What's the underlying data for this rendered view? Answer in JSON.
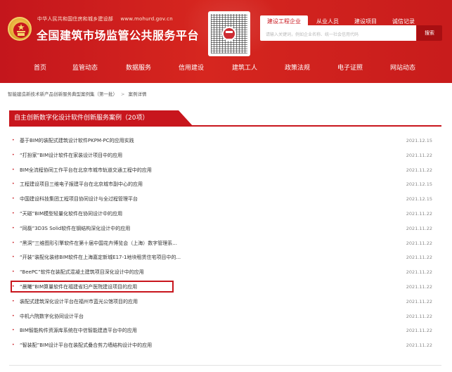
{
  "header": {
    "ministry_name": "中华人民共和国住房和城乡建设部",
    "ministry_url": "www.mohurd.gov.cn",
    "site_title": "全国建筑市场监管公共服务平台",
    "search_tabs": [
      "建设工程企业",
      "从业人员",
      "建设项目",
      "诚信记录"
    ],
    "search_placeholder": "请输入关键词，例如企业名称、统一社会信用代码",
    "search_button": "搜索"
  },
  "nav": {
    "items": [
      "首页",
      "监管动态",
      "数据服务",
      "信用建设",
      "建筑工人",
      "政策法规",
      "电子证照",
      "网站动态"
    ]
  },
  "breadcrumb": {
    "parent": "智能建造新技术新产品创新服务典型案例集（第一批）",
    "separator": ">",
    "current": "案例详情"
  },
  "section": {
    "title": "自主创新数字化设计软件创新服务案例（20项）"
  },
  "list": [
    {
      "title": "基于BIM的装配式建筑设计软件PKPM-PC的应用实践",
      "date": "2021.12.15"
    },
    {
      "title": "“打扮家”BIM设计软件在家装设计项目中的应用",
      "date": "2021.11.22"
    },
    {
      "title": "BIM全流程协同工作平台在北京市城市轨道交通工程中的应用",
      "date": "2021.11.22"
    },
    {
      "title": "工程建设项目三维电子报建平台在北京城市副中心的应用",
      "date": "2021.12.15"
    },
    {
      "title": "中国建设科技集团工程项目协同设计与全过程管理平台",
      "date": "2021.12.15"
    },
    {
      "title": "“天磁”BIM模型轻量化软件在协同设计中的应用",
      "date": "2021.11.22"
    },
    {
      "title": "“同磊”3D3S Solid软件在钢结构深化设计中的应用",
      "date": "2021.11.22"
    },
    {
      "title": "“黑洞”三维图形引擎软件在第十届中国花卉博览会（上海）数字管理系...",
      "date": "2021.11.22"
    },
    {
      "title": "“开装”装配化装修BIM软件在上海嘉定新城E17-1地块租赁住宅项目中的...",
      "date": "2021.11.22"
    },
    {
      "title": "“BeePC”软件在装配式混凝土建筑项目深化设计中的应用",
      "date": "2021.11.22"
    },
    {
      "title": "“晨曦”BIM算量软件在福建省妇产医院建设项目的应用",
      "date": "2021.11.22",
      "highlighted": true
    },
    {
      "title": "装配式建筑深化设计平台在福州市蓝光公馆项目的应用",
      "date": "2021.11.22"
    },
    {
      "title": "中机六院数字化协同设计平台",
      "date": "2021.11.22"
    },
    {
      "title": "BIM智能构件资源库系统在中信智能建造平台中的应用",
      "date": "2021.11.22"
    },
    {
      "title": "“智装配”BIM设计平台在装配式叠合剪力墙结构设计中的应用",
      "date": "2021.11.22"
    }
  ],
  "colors": {
    "brand_red": "#c8161d",
    "header_red": "#d6261f",
    "text": "#333333",
    "date": "#888888"
  }
}
